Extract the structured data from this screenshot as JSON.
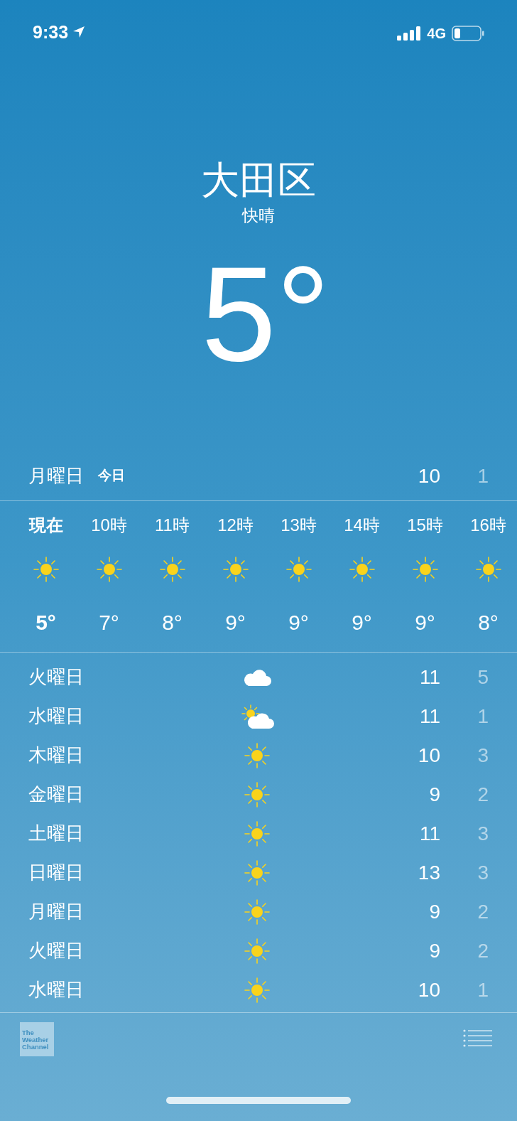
{
  "status_bar": {
    "time": "9:33",
    "network": "4G"
  },
  "location": {
    "city": "大田区",
    "condition": "快晴",
    "temperature": "5°"
  },
  "today": {
    "day": "月曜日",
    "label": "今日",
    "high": "10",
    "low": "1"
  },
  "hourly": [
    {
      "time": "現在",
      "kind": "sun",
      "temp": "5°",
      "selected": true
    },
    {
      "time": "10時",
      "kind": "sun",
      "temp": "7°",
      "selected": false
    },
    {
      "time": "11時",
      "kind": "sun",
      "temp": "8°",
      "selected": false
    },
    {
      "time": "12時",
      "kind": "sun",
      "temp": "9°",
      "selected": false
    },
    {
      "time": "13時",
      "kind": "sun",
      "temp": "9°",
      "selected": false
    },
    {
      "time": "14時",
      "kind": "sun",
      "temp": "9°",
      "selected": false
    },
    {
      "time": "15時",
      "kind": "sun",
      "temp": "9°",
      "selected": false
    },
    {
      "time": "16時",
      "kind": "sun",
      "temp": "8°",
      "selected": false
    }
  ],
  "daily": [
    {
      "day": "火曜日",
      "kind": "cloud",
      "high": "11",
      "low": "5"
    },
    {
      "day": "水曜日",
      "kind": "partly_cloudy",
      "high": "11",
      "low": "1"
    },
    {
      "day": "木曜日",
      "kind": "sun",
      "high": "10",
      "low": "3"
    },
    {
      "day": "金曜日",
      "kind": "sun",
      "high": "9",
      "low": "2"
    },
    {
      "day": "土曜日",
      "kind": "sun",
      "high": "11",
      "low": "3"
    },
    {
      "day": "日曜日",
      "kind": "sun",
      "high": "13",
      "low": "3"
    },
    {
      "day": "月曜日",
      "kind": "sun",
      "high": "9",
      "low": "2"
    },
    {
      "day": "火曜日",
      "kind": "sun",
      "high": "9",
      "low": "2"
    },
    {
      "day": "水曜日",
      "kind": "sun",
      "high": "10",
      "low": "1"
    }
  ],
  "footer": {
    "logo_text": "The Weather Channel"
  }
}
